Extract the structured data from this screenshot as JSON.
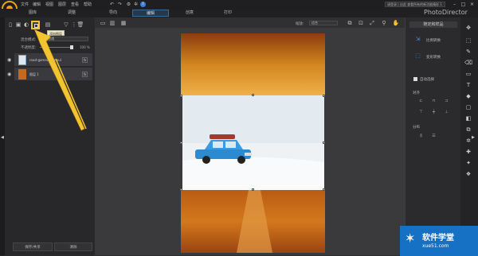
{
  "app": {
    "name": "PhotoDirector"
  },
  "menu": [
    "文件",
    "编辑",
    "视图",
    "图层",
    "查看",
    "帮助"
  ],
  "login_text": "请登录 | 自此 查看所有的新功能精彩 1",
  "tabs": [
    {
      "label": "图库"
    },
    {
      "label": "调整"
    },
    {
      "label": "导向"
    },
    {
      "label": "编辑"
    },
    {
      "label": "创意"
    },
    {
      "label": "打印"
    }
  ],
  "tooltip": "添加图层",
  "blend": {
    "label": "混合模式:",
    "value": "普通"
  },
  "opacity": {
    "label": "不透明度:",
    "value": "100 %",
    "level": 1.0
  },
  "layers": [
    {
      "name": "road-gomez-s...paul"
    },
    {
      "name": "图层 1"
    }
  ],
  "fx_label": "fx",
  "bottom_buttons": {
    "save": "保存/共享",
    "clear": "清除"
  },
  "zoom": {
    "label": "缩放:",
    "value": "适合"
  },
  "right_panel": {
    "title": "随定和样品",
    "item1": "比例转换",
    "item2": "变形转换",
    "auto_select": "自动选择",
    "align_label": "对齐",
    "distribute_label": "分布"
  },
  "watermark": {
    "brand": "软件学堂",
    "url": "xue51.com"
  },
  "colors": {
    "accent_tooltip_ring": "#f3c431",
    "active_tab": "#26384a",
    "blue_icon": "#4a8fd6"
  }
}
